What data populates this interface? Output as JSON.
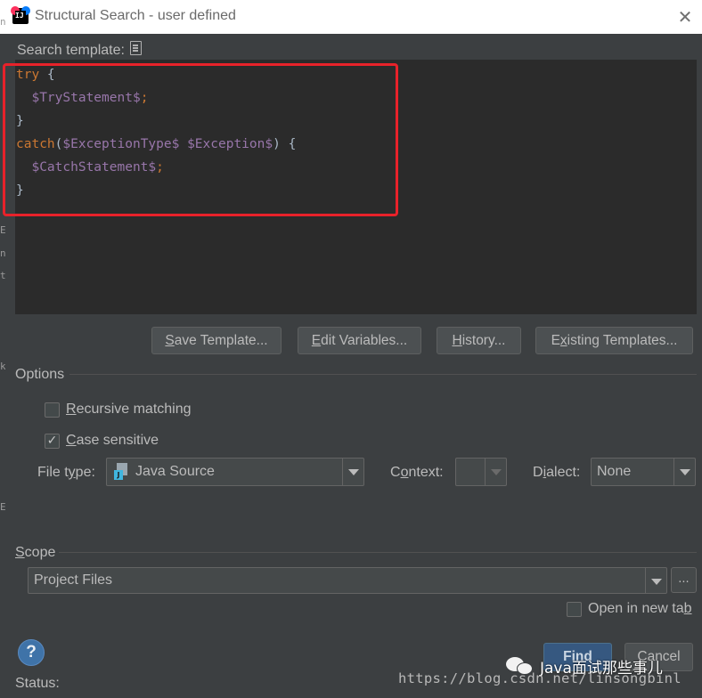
{
  "window": {
    "title": "Structural Search - user defined",
    "close_glyph": "✕"
  },
  "search_template": {
    "label": "Search template:",
    "code": [
      [
        {
          "t": "kw",
          "s": "try"
        },
        {
          "t": "pl",
          "s": " {"
        }
      ],
      [
        {
          "t": "pl",
          "s": "  "
        },
        {
          "t": "var",
          "s": "$TryStatement$"
        },
        {
          "t": "kw",
          "s": ";"
        }
      ],
      [
        {
          "t": "pl",
          "s": "}"
        }
      ],
      [
        {
          "t": "kw",
          "s": "catch"
        },
        {
          "t": "pl",
          "s": "("
        },
        {
          "t": "var",
          "s": "$ExceptionType$"
        },
        {
          "t": "pl",
          "s": " "
        },
        {
          "t": "var",
          "s": "$Exception$"
        },
        {
          "t": "pl",
          "s": ") {"
        }
      ],
      [
        {
          "t": "pl",
          "s": "  "
        },
        {
          "t": "var",
          "s": "$CatchStatement$"
        },
        {
          "t": "kw",
          "s": ";"
        }
      ],
      [
        {
          "t": "pl",
          "s": "}"
        }
      ]
    ],
    "annotation_color": "#e8222a"
  },
  "template_buttons": {
    "save": {
      "u": "S",
      "rest": "ave Template..."
    },
    "edit_variables": {
      "u": "E",
      "rest": "dit Variables..."
    },
    "history": {
      "u": "H",
      "rest": "istory..."
    },
    "existing_templates": {
      "pre": "E",
      "u": "x",
      "rest": "isting Templates..."
    }
  },
  "options": {
    "header": "Options",
    "recursive": {
      "u": "R",
      "rest": "ecursive matching",
      "checked": false
    },
    "case_sensitive": {
      "u": "C",
      "rest": "ase sensitive",
      "checked": true,
      "check_glyph": "✓"
    },
    "file_type": {
      "pre": "File t",
      "u": "y",
      "rest": "pe:",
      "value": "Java Source",
      "icon_letter": "J"
    },
    "context": {
      "pre": "C",
      "u": "o",
      "rest": "ntext:",
      "value": ""
    },
    "dialect": {
      "pre": "D",
      "u": "i",
      "rest": "alect:",
      "value": "None"
    }
  },
  "scope": {
    "u": "S",
    "rest": "cope",
    "value": "Project Files",
    "more_glyph": "...",
    "open_new_tab": {
      "pre": "Open in new ta",
      "u": "b",
      "checked": false
    }
  },
  "footer": {
    "help_glyph": "?",
    "status_label": "Status:",
    "find": "Find",
    "cancel": "Cancel"
  },
  "watermarks": {
    "wechat": "Java面试那些事儿",
    "url": "https://blog.csdn.net/linsongbinl"
  },
  "colors": {
    "background": "#3c3f41",
    "editor_bg": "#2b2b2b",
    "keyword": "#cc7832",
    "template_variable": "#9876aa",
    "find_button": "#365880"
  }
}
